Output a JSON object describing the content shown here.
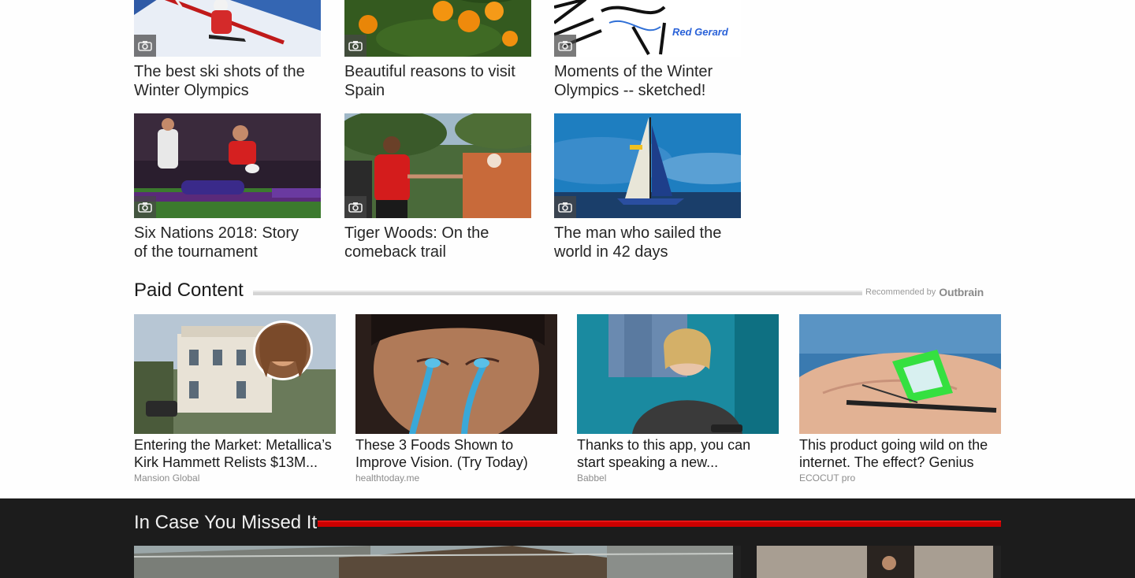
{
  "gallery": {
    "cards": [
      {
        "title": "The best ski shots of the Winter Olympics",
        "icon": "camera-icon"
      },
      {
        "title": "Beautiful reasons to visit Spain",
        "icon": "camera-icon"
      },
      {
        "title": "Moments of the Winter Olympics -- sketched!",
        "icon": "camera-icon",
        "image_text": "Red Gerard"
      },
      {
        "title": "Six Nations 2018: Story of the tournament",
        "icon": "camera-icon"
      },
      {
        "title": "Tiger Woods: On the comeback trail",
        "icon": "camera-icon"
      },
      {
        "title": "The man who sailed the world in 42 days",
        "icon": "camera-icon"
      }
    ]
  },
  "paid": {
    "title": "Paid Content",
    "recommended_by": "Recommended by",
    "provider_logo": "Outbrain",
    "cards": [
      {
        "title": "Entering the Market: Metallica’s Kirk Hammett Relists $13M...",
        "source": "Mansion Global"
      },
      {
        "title": "These 3 Foods Shown to Improve Vision. (Try Today)",
        "source": "healthtoday.me"
      },
      {
        "title": "Thanks to this app, you can start speaking a new...",
        "source": "Babbel"
      },
      {
        "title": "This product going wild on the internet. The effect? Genius",
        "source": "ECOCUT pro"
      }
    ]
  },
  "missed": {
    "title": "In Case You Missed It"
  },
  "colors": {
    "accent_red": "#cc0000",
    "dark_bg": "#1c1c1c",
    "rule_gray": "#d4d4d4"
  }
}
